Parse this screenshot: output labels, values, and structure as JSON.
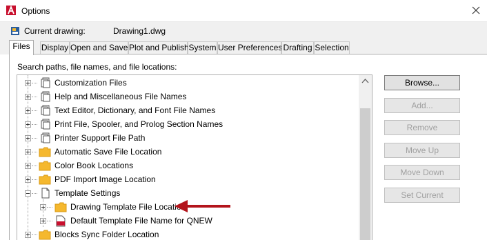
{
  "window": {
    "title": "Options",
    "icon": "autocad-a-icon",
    "close_icon": "close-icon"
  },
  "drawing": {
    "label": "Current drawing:",
    "value": "Drawing1.dwg",
    "icon": "drawing-file-icon"
  },
  "tabs": [
    {
      "label": "Files",
      "active": true
    },
    {
      "label": "Display"
    },
    {
      "label": "Open and Save"
    },
    {
      "label": "Plot and Publish"
    },
    {
      "label": "System"
    },
    {
      "label": "User Preferences"
    },
    {
      "label": "Drafting"
    },
    {
      "label": "Selection"
    }
  ],
  "files_panel": {
    "label": "Search paths, file names, and file locations:",
    "tree": [
      {
        "label": "Customization Files",
        "icon": "file-stack-icon",
        "expanded": false
      },
      {
        "label": "Help and Miscellaneous File Names",
        "icon": "file-stack-icon",
        "expanded": false
      },
      {
        "label": "Text Editor, Dictionary, and Font File Names",
        "icon": "file-stack-icon",
        "expanded": false
      },
      {
        "label": "Print File, Spooler, and Prolog Section Names",
        "icon": "file-stack-icon",
        "expanded": false
      },
      {
        "label": "Printer Support File Path",
        "icon": "file-stack-icon",
        "expanded": false
      },
      {
        "label": "Automatic Save File Location",
        "icon": "folder-icon",
        "expanded": false
      },
      {
        "label": "Color Book Locations",
        "icon": "folder-icon",
        "expanded": false
      },
      {
        "label": "PDF Import Image Location",
        "icon": "folder-icon",
        "expanded": false
      },
      {
        "label": "Template Settings",
        "icon": "document-icon",
        "expanded": true
      },
      {
        "label": "Drawing Template File Location",
        "icon": "folder-icon",
        "expanded": false,
        "child": true,
        "annotated": true
      },
      {
        "label": "Default Template File Name for QNEW",
        "icon": "dwt-file-icon",
        "expanded": false,
        "child": true
      },
      {
        "label": "Blocks Sync Folder Location",
        "icon": "folder-icon",
        "expanded": false
      }
    ]
  },
  "buttons": {
    "browse": "Browse...",
    "add": "Add...",
    "remove": "Remove",
    "move_up": "Move Up",
    "move_down": "Move Down",
    "set_current": "Set Current"
  },
  "colors": {
    "folder": "#f5b82e",
    "arrow": "#b3141b",
    "app_icon": "#c8102e",
    "dwt": "#c8102e"
  }
}
